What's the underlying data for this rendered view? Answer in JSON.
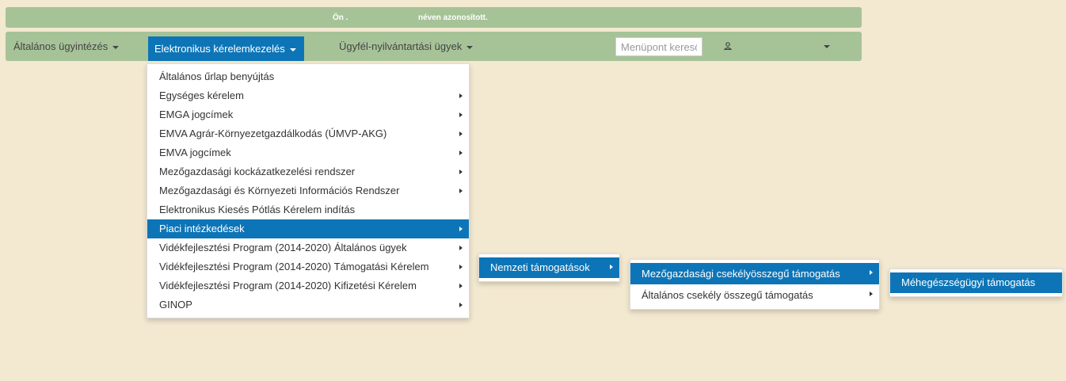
{
  "banner": {
    "part1": "Ön .",
    "part2": "néven azonosított."
  },
  "nav": {
    "items": [
      {
        "label": "Általános ügyintézés"
      },
      {
        "label": "Elektronikus kérelemkezelés"
      },
      {
        "label": "Ügyfél-nyilvántartási ügyek"
      }
    ],
    "search_placeholder": "Menüpont kereső",
    "user_icon": "user-icon"
  },
  "menu": {
    "items": [
      {
        "label": "Általános űrlap benyújtás"
      },
      {
        "label": "Egységes kérelem"
      },
      {
        "label": "EMGA jogcímek"
      },
      {
        "label": "EMVA Agrár-Környezetgazdálkodás (ÚMVP-AKG)"
      },
      {
        "label": "EMVA jogcímek"
      },
      {
        "label": "Mezőgazdasági kockázatkezelési rendszer"
      },
      {
        "label": "Mezőgazdasági és Környezeti Információs Rendszer"
      },
      {
        "label": "Elektronikus Kiesés Pótlás Kérelem indítás"
      },
      {
        "label": "Piaci intézkedések"
      },
      {
        "label": "Vidékfejlesztési Program (2014-2020) Általános ügyek"
      },
      {
        "label": "Vidékfejlesztési Program (2014-2020) Támogatási Kérelem"
      },
      {
        "label": "Vidékfejlesztési Program (2014-2020) Kifizetési Kérelem"
      },
      {
        "label": "GINOP"
      }
    ]
  },
  "submenu1": {
    "items": [
      {
        "label": "Nemzeti támogatások"
      }
    ]
  },
  "submenu2": {
    "items": [
      {
        "label": "Mezőgazdasági csekélyösszegű támogatás"
      },
      {
        "label": "Általános csekély összegű támogatás"
      }
    ]
  },
  "submenu3": {
    "items": [
      {
        "label": "Méhegészségügyi támogatás"
      }
    ]
  },
  "colors": {
    "background": "#f3e8d0",
    "bar": "#a6c398",
    "accent": "#0d75b7"
  }
}
